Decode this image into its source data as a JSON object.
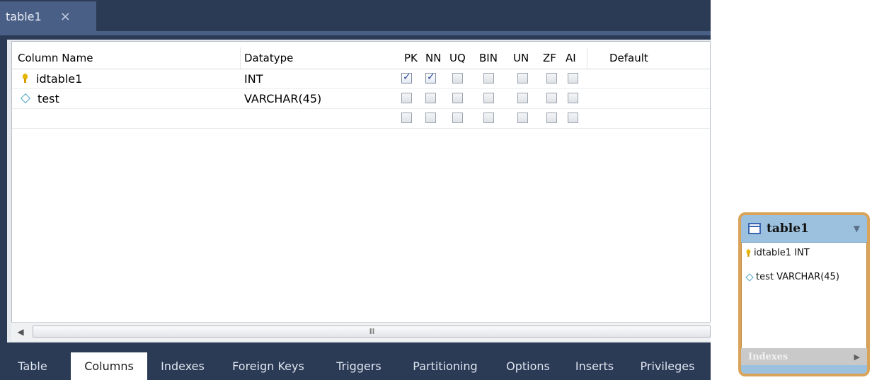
{
  "document_tab": {
    "title": "table1",
    "close": "×"
  },
  "grid": {
    "headers": {
      "column_name": "Column Name",
      "datatype": "Datatype",
      "pk": "PK",
      "nn": "NN",
      "uq": "UQ",
      "bin": "BIN",
      "un": "UN",
      "zf": "ZF",
      "ai": "AI",
      "default": "Default"
    },
    "rows": [
      {
        "name": "idtable1",
        "type": "INT",
        "icon": "primary-key-icon",
        "flags": {
          "pk": true,
          "nn": true,
          "uq": false,
          "bin": false,
          "un": false,
          "zf": false,
          "ai": false
        }
      },
      {
        "name": "test",
        "type": "VARCHAR(45)",
        "icon": "column-diamond-icon",
        "flags": {
          "pk": false,
          "nn": false,
          "uq": false,
          "bin": false,
          "un": false,
          "zf": false,
          "ai": false
        }
      },
      {
        "name": "",
        "type": "",
        "icon": "",
        "flags": {
          "pk": false,
          "nn": false,
          "uq": false,
          "bin": false,
          "un": false,
          "zf": false,
          "ai": false
        }
      }
    ]
  },
  "scrollbar": {
    "left_arrow": "◀",
    "thumb_grip": "III"
  },
  "bottom_tabs": [
    "Table",
    "Columns",
    "Indexes",
    "Foreign Keys",
    "Triggers",
    "Partitioning",
    "Options",
    "Inserts",
    "Privileges"
  ],
  "active_bottom_tab": "Columns",
  "diagram_card": {
    "title": "table1",
    "collapse": "▼",
    "columns": [
      {
        "text": "idtable1 INT",
        "icon": "primary-key-icon"
      },
      {
        "text": "test VARCHAR(45)",
        "icon": "column-diamond-icon"
      }
    ],
    "footer": "Indexes",
    "footer_arrow": "▶"
  },
  "colors": {
    "chrome_dark": "#2b3a55",
    "tab_active": "#4a5f86",
    "card_border": "#d9a45a",
    "card_header": "#9cc1de"
  }
}
